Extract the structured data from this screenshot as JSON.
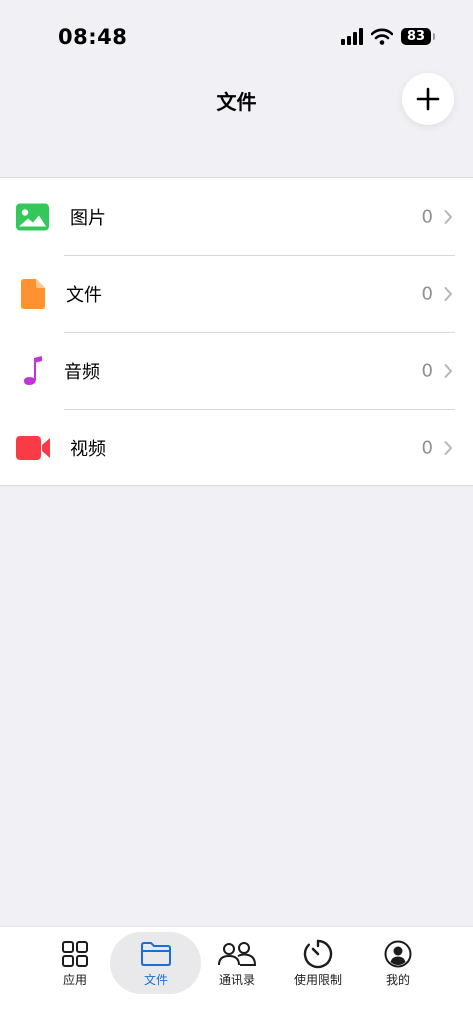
{
  "status_bar": {
    "time": "08:48",
    "battery": "83"
  },
  "header": {
    "title": "文件"
  },
  "list": {
    "items": [
      {
        "label": "图片",
        "count": "0",
        "icon": "image-icon",
        "color": "#34c759"
      },
      {
        "label": "文件",
        "count": "0",
        "icon": "document-icon",
        "color": "#ff9230"
      },
      {
        "label": "音频",
        "count": "0",
        "icon": "music-note-icon",
        "color": "#c135d8"
      },
      {
        "label": "视频",
        "count": "0",
        "icon": "video-camera-icon",
        "color": "#fa3a45"
      }
    ]
  },
  "tab_bar": {
    "tabs": [
      {
        "label": "应用",
        "icon": "apps-grid-icon"
      },
      {
        "label": "文件",
        "icon": "folder-icon",
        "active": true
      },
      {
        "label": "通讯录",
        "icon": "contacts-icon"
      },
      {
        "label": "使用限制",
        "icon": "timer-icon"
      },
      {
        "label": "我的",
        "icon": "profile-icon"
      }
    ],
    "active_color": "#1a6fd6"
  }
}
